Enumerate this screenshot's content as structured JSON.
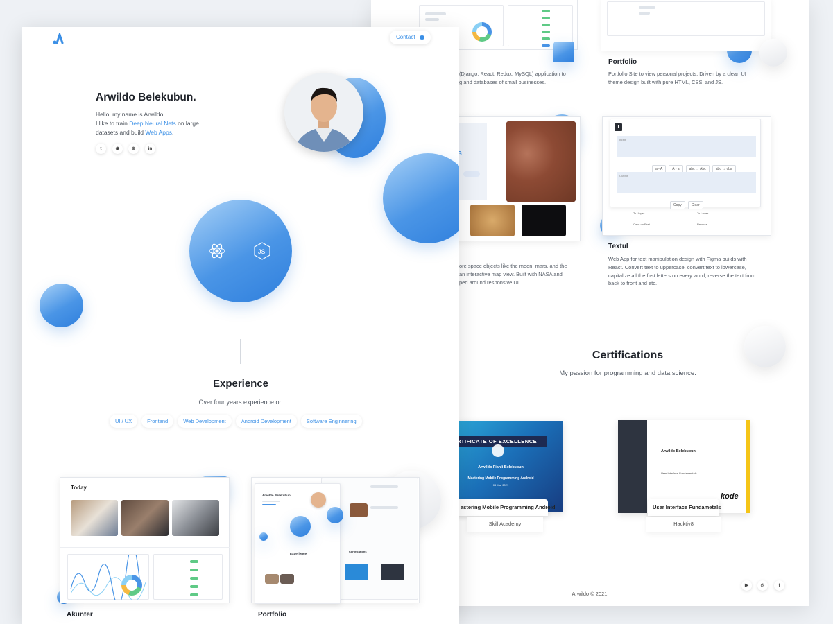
{
  "back": {
    "projects": [
      {
        "desc": "(Django, React, Redux, MySQL) application to\ng and databases of small businesses."
      },
      {
        "title": "Portfolio",
        "desc": "Portfolio Site to view personal projects. Driven by a clean UI\ntheme design built with pure HTML, CSS, and JS."
      },
      {
        "desc": "ore space objects like the moon, mars, and the\nan interactive map view. Built with NASA and\nped around responsive UI"
      },
      {
        "title": "Textul",
        "desc": "Web App for text manipulation design with Figma builds with\nReact. Convert text to uppercase, convert text to lowercase,\ncapitalize all the first letters on every word, reverse the text from\nback to front and etc."
      }
    ],
    "space_shot": {
      "heading_1": "w",
      "heading_2": "cts"
    },
    "textul_shot": {
      "logo": "T",
      "input_placeholder": "Input",
      "output_placeholder": "Output",
      "buttons": [
        "a - A",
        "A - a",
        "abc → Abc",
        "abc → cba"
      ],
      "copy": "Copy",
      "clear": "Clear",
      "features": [
        "To Upper",
        "To Lower",
        "Caps on First",
        "Reverse"
      ]
    },
    "certifications": {
      "title": "Certifications",
      "subtitle": "My passion for programming and data science.",
      "items": [
        {
          "name": "astering Mobile Programming Android",
          "issuer": "Skill Academy",
          "banner": "RTIFICATE OF EXCELLENCE",
          "recipient": "Arwildo Fianli Belekubun",
          "course": "Mastering Mobile Programming Android",
          "date": "05 Mar 2021"
        },
        {
          "name": "User Interface Fundametals",
          "issuer": "Hacktiv8",
          "recipient": "Arwildo Belekubun",
          "course": "User Interface Fundamentals",
          "brand": "kode"
        }
      ]
    },
    "footer": {
      "copyright": "Arwildo © 2021",
      "icons": [
        "youtube-icon",
        "instagram-icon",
        "facebook-icon"
      ]
    }
  },
  "front": {
    "contact_label": "Contact",
    "hero": {
      "name": "Arwildo Belekubun.",
      "line1": "Hello, my name is Arwildo.",
      "line2_pre": "I like to train ",
      "line2_link": "Deep Neural Nets",
      "line2_post": " on large",
      "line3_pre": "datasets and build ",
      "line3_link": "Web Apps",
      "line3_post": ".",
      "socials": [
        "twitter-icon",
        "github-icon",
        "dribbble-icon",
        "linkedin-icon"
      ]
    },
    "tech_icons": [
      "react-icon",
      "nodejs-icon"
    ],
    "experience": {
      "title": "Experience",
      "subtitle": "Over four years experience on",
      "tags": [
        "UI / UX",
        "Frontend",
        "Web Development",
        "Android Development",
        "Software Enginnering"
      ]
    },
    "akunter_shot": {
      "heading": "Today"
    },
    "portfolio_shot": {
      "name": "Arwildo Belekubun",
      "section_1": "Experience",
      "section_2": "Certifications"
    },
    "projects": [
      {
        "title": "Akunter"
      },
      {
        "title": "Portfolio"
      }
    ]
  },
  "colors": {
    "accent": "#3a8fe6",
    "ball": "#4a95e6",
    "text": "#1f232a"
  }
}
